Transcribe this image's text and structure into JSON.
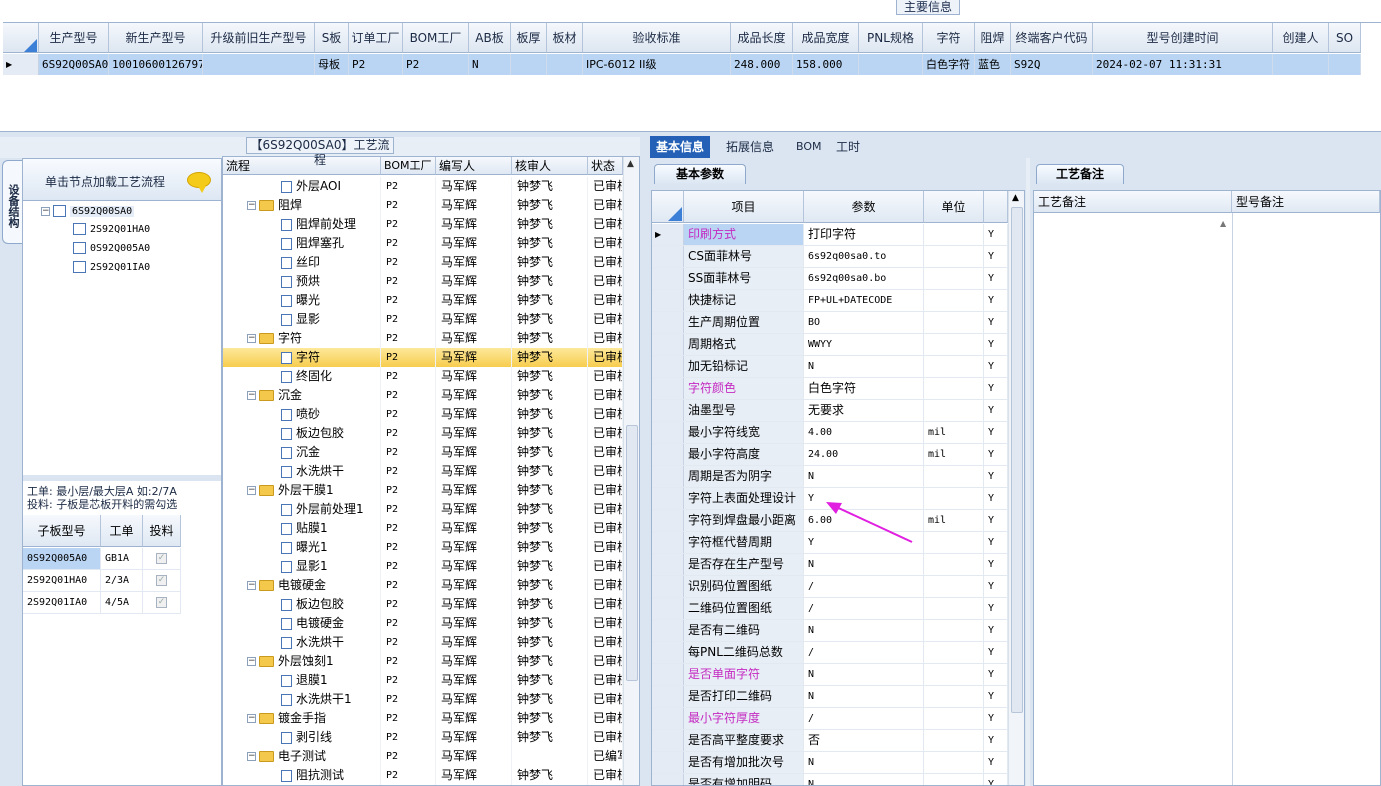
{
  "top_panel": {
    "title": "主要信息",
    "columns": [
      "生产型号",
      "新生产型号",
      "升级前旧生产型号",
      "S板",
      "订单工厂",
      "BOM工厂",
      "AB板",
      "板厚",
      "板材",
      "验收标准",
      "成品长度",
      "成品宽度",
      "PNL规格",
      "字符",
      "阻焊",
      "终端客户代码",
      "型号创建时间",
      "创建人",
      "SO"
    ],
    "row": [
      "6S92Q00SA0",
      "10010600126797",
      "",
      "母板",
      "P2",
      "P2",
      "N",
      "",
      "",
      "IPC-6012 II级",
      "248.000",
      "158.000",
      "",
      "白色字符",
      "蓝色",
      "S92Q",
      "2024-02-07 11:31:31",
      "",
      ""
    ]
  },
  "left_panel": {
    "vertical_tab": "设备结构",
    "header": "单击节点加载工艺流程",
    "tree": {
      "root": "6S92Q00SA0",
      "children": [
        "2S92Q01HA0",
        "0S92Q005A0",
        "2S92Q01IA0"
      ]
    },
    "note_line1": "工单: 最小层/最大层A 如:2/7A",
    "note_line2": "投料: 子板是芯板开料的需勾选",
    "sub_grid": {
      "headers": [
        "子板型号",
        "工单",
        "投料"
      ],
      "rows": [
        {
          "model": "0S92Q005A0",
          "order": "GB1A",
          "checked": true
        },
        {
          "model": "2S92Q01HA0",
          "order": "2/3A",
          "checked": true
        },
        {
          "model": "2S92Q01IA0",
          "order": "4/5A",
          "checked": true
        }
      ]
    }
  },
  "process_panel": {
    "title": "【6S92Q00SA0】工艺流程",
    "headers": [
      "流程",
      "BOM工厂",
      "编写人",
      "核审人",
      "状态"
    ],
    "rows": [
      {
        "name": "外层AOI",
        "type": "leaf",
        "bom": "P2",
        "writer": "马军辉",
        "reviewer": "钟梦飞",
        "status": "已审核"
      },
      {
        "name": "阻焊",
        "type": "folder",
        "bom": "P2",
        "writer": "马军辉",
        "reviewer": "钟梦飞",
        "status": "已审核"
      },
      {
        "name": "阻焊前处理",
        "type": "leaf",
        "bom": "P2",
        "writer": "马军辉",
        "reviewer": "钟梦飞",
        "status": "已审核"
      },
      {
        "name": "阻焊塞孔",
        "type": "leaf",
        "bom": "P2",
        "writer": "马军辉",
        "reviewer": "钟梦飞",
        "status": "已审核"
      },
      {
        "name": "丝印",
        "type": "leaf",
        "bom": "P2",
        "writer": "马军辉",
        "reviewer": "钟梦飞",
        "status": "已审核"
      },
      {
        "name": "预烘",
        "type": "leaf",
        "bom": "P2",
        "writer": "马军辉",
        "reviewer": "钟梦飞",
        "status": "已审核"
      },
      {
        "name": "曝光",
        "type": "leaf",
        "bom": "P2",
        "writer": "马军辉",
        "reviewer": "钟梦飞",
        "status": "已审核"
      },
      {
        "name": "显影",
        "type": "leaf",
        "bom": "P2",
        "writer": "马军辉",
        "reviewer": "钟梦飞",
        "status": "已审核"
      },
      {
        "name": "字符",
        "type": "folder",
        "bom": "P2",
        "writer": "马军辉",
        "reviewer": "钟梦飞",
        "status": "已审核"
      },
      {
        "name": "字符",
        "type": "leaf",
        "bom": "P2",
        "writer": "马军辉",
        "reviewer": "钟梦飞",
        "status": "已审核",
        "selected": true
      },
      {
        "name": "终固化",
        "type": "leaf",
        "bom": "P2",
        "writer": "马军辉",
        "reviewer": "钟梦飞",
        "status": "已审核"
      },
      {
        "name": "沉金",
        "type": "folder",
        "bom": "P2",
        "writer": "马军辉",
        "reviewer": "钟梦飞",
        "status": "已审核"
      },
      {
        "name": "喷砂",
        "type": "leaf",
        "bom": "P2",
        "writer": "马军辉",
        "reviewer": "钟梦飞",
        "status": "已审核"
      },
      {
        "name": "板边包胶",
        "type": "leaf",
        "bom": "P2",
        "writer": "马军辉",
        "reviewer": "钟梦飞",
        "status": "已审核"
      },
      {
        "name": "沉金",
        "type": "leaf",
        "bom": "P2",
        "writer": "马军辉",
        "reviewer": "钟梦飞",
        "status": "已审核"
      },
      {
        "name": "水洗烘干",
        "type": "leaf",
        "bom": "P2",
        "writer": "马军辉",
        "reviewer": "钟梦飞",
        "status": "已审核"
      },
      {
        "name": "外层干膜1",
        "type": "folder",
        "bom": "P2",
        "writer": "马军辉",
        "reviewer": "钟梦飞",
        "status": "已审核"
      },
      {
        "name": "外层前处理1",
        "type": "leaf",
        "bom": "P2",
        "writer": "马军辉",
        "reviewer": "钟梦飞",
        "status": "已审核"
      },
      {
        "name": "贴膜1",
        "type": "leaf",
        "bom": "P2",
        "writer": "马军辉",
        "reviewer": "钟梦飞",
        "status": "已审核"
      },
      {
        "name": "曝光1",
        "type": "leaf",
        "bom": "P2",
        "writer": "马军辉",
        "reviewer": "钟梦飞",
        "status": "已审核"
      },
      {
        "name": "显影1",
        "type": "leaf",
        "bom": "P2",
        "writer": "马军辉",
        "reviewer": "钟梦飞",
        "status": "已审核"
      },
      {
        "name": "电镀硬金",
        "type": "folder",
        "bom": "P2",
        "writer": "马军辉",
        "reviewer": "钟梦飞",
        "status": "已审核"
      },
      {
        "name": "板边包胶",
        "type": "leaf",
        "bom": "P2",
        "writer": "马军辉",
        "reviewer": "钟梦飞",
        "status": "已审核"
      },
      {
        "name": "电镀硬金",
        "type": "leaf",
        "bom": "P2",
        "writer": "马军辉",
        "reviewer": "钟梦飞",
        "status": "已审核"
      },
      {
        "name": "水洗烘干",
        "type": "leaf",
        "bom": "P2",
        "writer": "马军辉",
        "reviewer": "钟梦飞",
        "status": "已审核"
      },
      {
        "name": "外层蚀刻1",
        "type": "folder",
        "bom": "P2",
        "writer": "马军辉",
        "reviewer": "钟梦飞",
        "status": "已审核"
      },
      {
        "name": "退膜1",
        "type": "leaf",
        "bom": "P2",
        "writer": "马军辉",
        "reviewer": "钟梦飞",
        "status": "已审核"
      },
      {
        "name": "水洗烘干1",
        "type": "leaf",
        "bom": "P2",
        "writer": "马军辉",
        "reviewer": "钟梦飞",
        "status": "已审核"
      },
      {
        "name": "镀金手指",
        "type": "folder",
        "bom": "P2",
        "writer": "马军辉",
        "reviewer": "钟梦飞",
        "status": "已审核"
      },
      {
        "name": "剥引线",
        "type": "leaf",
        "bom": "P2",
        "writer": "马军辉",
        "reviewer": "钟梦飞",
        "status": "已审核"
      },
      {
        "name": "电子测试",
        "type": "folder",
        "bom": "P2",
        "writer": "马军辉",
        "reviewer": "",
        "status": "已编写"
      },
      {
        "name": "阻抗测试",
        "type": "leaf",
        "bom": "P2",
        "writer": "马军辉",
        "reviewer": "钟梦飞",
        "status": "已审核"
      }
    ]
  },
  "tabs": [
    "基本信息",
    "拓展信息",
    "BOM",
    "工时"
  ],
  "basic_params": {
    "tab": "基本参数",
    "headers": [
      "项目",
      "参数",
      "单位",
      ""
    ],
    "rows": [
      {
        "item": "印刷方式",
        "value": "打印字符",
        "unit": "",
        "flag": "Y",
        "style": "selected"
      },
      {
        "item": "CS面菲林号",
        "value": "6s92q00sa0.to",
        "unit": "",
        "flag": "Y",
        "mono": true
      },
      {
        "item": "SS面菲林号",
        "value": "6s92q00sa0.bo",
        "unit": "",
        "flag": "Y",
        "mono": true
      },
      {
        "item": "快捷标记",
        "value": "FP+UL+DATECODE",
        "unit": "",
        "flag": "Y",
        "mono": true
      },
      {
        "item": "生产周期位置",
        "value": "BO",
        "unit": "",
        "flag": "Y",
        "mono": true
      },
      {
        "item": "周期格式",
        "value": "WWYY",
        "unit": "",
        "flag": "Y",
        "mono": true
      },
      {
        "item": "加无铅标记",
        "value": "N",
        "unit": "",
        "flag": "Y",
        "mono": true
      },
      {
        "item": "字符颜色",
        "value": "白色字符",
        "unit": "",
        "flag": "Y",
        "style": "pink"
      },
      {
        "item": "油墨型号",
        "value": "无要求",
        "unit": "",
        "flag": "Y"
      },
      {
        "item": "最小字符线宽",
        "value": "4.00",
        "unit": "mil",
        "flag": "Y",
        "mono": true
      },
      {
        "item": "最小字符高度",
        "value": "24.00",
        "unit": "mil",
        "flag": "Y",
        "mono": true
      },
      {
        "item": "周期是否为阴字",
        "value": "N",
        "unit": "",
        "flag": "Y",
        "mono": true
      },
      {
        "item": "字符上表面处理设计",
        "value": "Y",
        "unit": "",
        "flag": "Y",
        "mono": true
      },
      {
        "item": "字符到焊盘最小距离",
        "value": "6.00",
        "unit": "mil",
        "flag": "Y",
        "mono": true
      },
      {
        "item": "字符框代替周期",
        "value": "Y",
        "unit": "",
        "flag": "Y",
        "mono": true
      },
      {
        "item": "是否存在生产型号",
        "value": "N",
        "unit": "",
        "flag": "Y",
        "mono": true
      },
      {
        "item": "识别码位置图纸",
        "value": "/",
        "unit": "",
        "flag": "Y",
        "mono": true
      },
      {
        "item": "二维码位置图纸",
        "value": "/",
        "unit": "",
        "flag": "Y",
        "mono": true
      },
      {
        "item": "是否有二维码",
        "value": "N",
        "unit": "",
        "flag": "Y",
        "mono": true
      },
      {
        "item": "每PNL二维码总数",
        "value": "/",
        "unit": "",
        "flag": "Y",
        "mono": true
      },
      {
        "item": "是否单面字符",
        "value": "N",
        "unit": "",
        "flag": "Y",
        "style": "pink",
        "mono": true
      },
      {
        "item": "是否打印二维码",
        "value": "N",
        "unit": "",
        "flag": "Y",
        "mono": true
      },
      {
        "item": "最小字符厚度",
        "value": "/",
        "unit": "",
        "flag": "Y",
        "style": "pink",
        "mono": true
      },
      {
        "item": "是否高平整度要求",
        "value": "否",
        "unit": "",
        "flag": "Y"
      },
      {
        "item": "是否有增加批次号",
        "value": "N",
        "unit": "",
        "flag": "Y",
        "mono": true
      },
      {
        "item": "是否有增加明码",
        "value": "N",
        "unit": "",
        "flag": "Y",
        "mono": true
      }
    ]
  },
  "remark_panel": {
    "tab": "工艺备注",
    "headers": [
      "工艺备注",
      "型号备注"
    ]
  },
  "colors": {
    "accent": "#2461b6",
    "selection": "#b9d5f3",
    "highlight_text": "#c42ac1",
    "arrow": "#e01fe0"
  }
}
